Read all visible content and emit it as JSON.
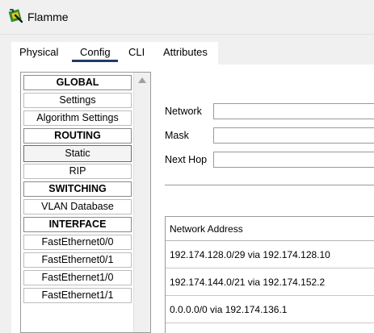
{
  "window": {
    "title": "Flamme",
    "icon": "router-icon"
  },
  "tabs": [
    {
      "label": "Physical"
    },
    {
      "label": "Config",
      "active": true
    },
    {
      "label": "CLI"
    },
    {
      "label": "Attributes"
    }
  ],
  "sidebar": {
    "items": [
      {
        "label": "GLOBAL",
        "header": true
      },
      {
        "label": "Settings"
      },
      {
        "label": "Algorithm Settings"
      },
      {
        "label": "ROUTING",
        "header": true
      },
      {
        "label": "Static",
        "selected": true
      },
      {
        "label": "RIP"
      },
      {
        "label": "SWITCHING",
        "header": true
      },
      {
        "label": "VLAN Database"
      },
      {
        "label": "INTERFACE",
        "header": true
      },
      {
        "label": "FastEthernet0/0"
      },
      {
        "label": "FastEthernet0/1"
      },
      {
        "label": "FastEthernet1/0"
      },
      {
        "label": "FastEthernet1/1"
      }
    ]
  },
  "form": {
    "network_label": "Network",
    "network_value": "",
    "mask_label": "Mask",
    "mask_value": "",
    "nexthop_label": "Next Hop",
    "nexthop_value": ""
  },
  "routes": {
    "header": "Network Address",
    "rows": [
      "192.174.128.0/29 via 192.174.128.10",
      "192.174.144.0/21 via 192.174.152.2",
      "0.0.0.0/0 via 192.174.136.1"
    ]
  },
  "colors": {
    "tab_underline": "#1f3b67",
    "icon_green": "#2e8b2e",
    "icon_yellow": "#e8c21a"
  }
}
